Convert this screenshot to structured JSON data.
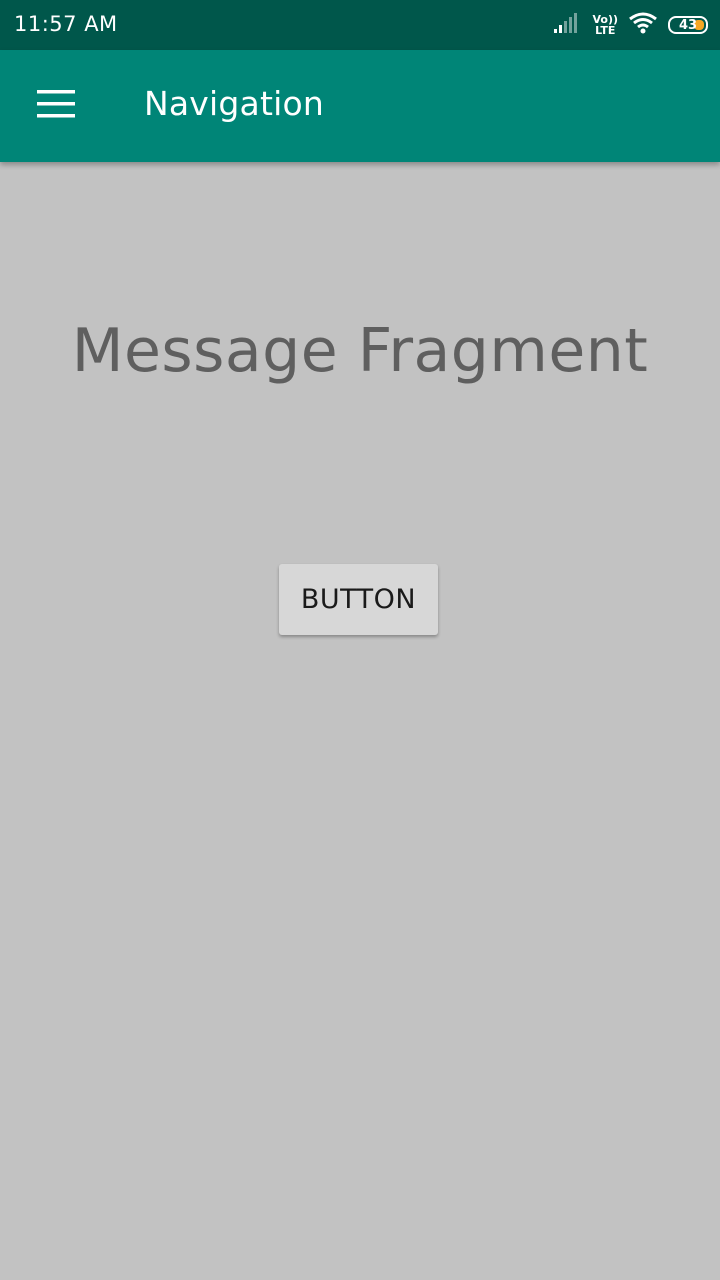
{
  "status_bar": {
    "time": "11:57 AM",
    "volte_top": "Vo))",
    "volte_bottom": "LTE",
    "battery_level": "43",
    "icons": [
      "signal-icon",
      "volte-icon",
      "wifi-icon",
      "battery-icon"
    ]
  },
  "app_bar": {
    "title": "Navigation",
    "menu_icon": "hamburger-menu-icon",
    "background_color": "#008577",
    "status_color": "#00574b"
  },
  "content": {
    "fragment_title": "Message Fragment",
    "button_label": "BUTTON",
    "background_color": "#c2c2c2"
  }
}
